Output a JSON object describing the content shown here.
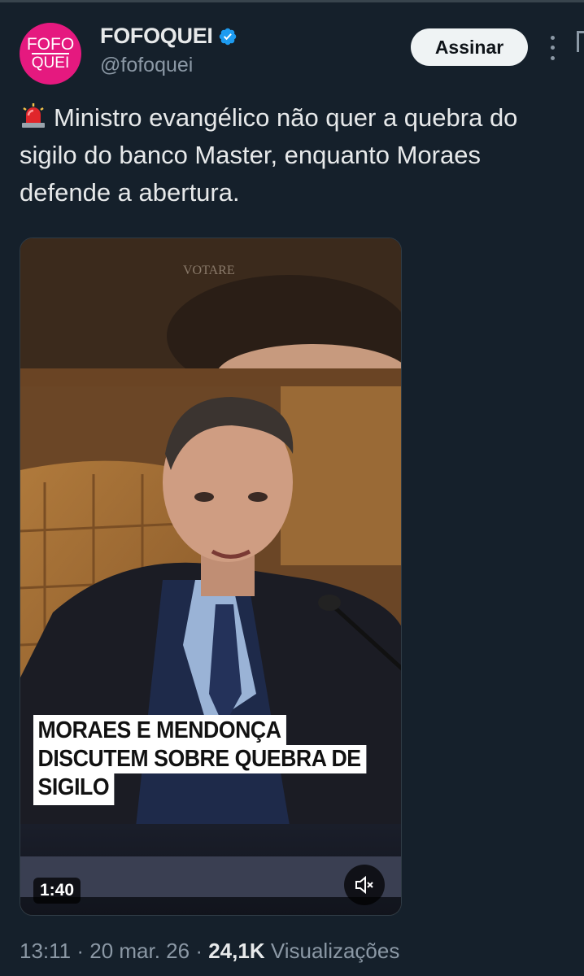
{
  "account": {
    "display_name": "FOFOQUEI",
    "handle": "@fofoquei",
    "avatar_logo_top": "FOFO",
    "avatar_logo_bottom": "QUEI",
    "avatar_color": "#e5197f",
    "verified": true,
    "verified_color": "#1d9bf0"
  },
  "actions": {
    "subscribe_label": "Assinar",
    "more_icon": "more-vertical-icon"
  },
  "tweet": {
    "emoji_icon": "siren-icon",
    "text": "Ministro evangélico não quer a quebra do sigilo do banco Master, enquanto Moraes defende a abertura."
  },
  "video": {
    "duration": "1:40",
    "caption_lines": [
      "MORAES E MENDONÇA",
      "DISCUTEM SOBRE QUEBRA DE",
      "SIGILO"
    ],
    "background_text": "VOTARE",
    "mute_icon": "muted-speaker-icon"
  },
  "meta": {
    "time": "13:11",
    "separator": " · ",
    "date": "20 mar. 26",
    "views_count": "24,1K",
    "views_label": "Visualizações"
  },
  "colors": {
    "background": "#15202b",
    "primary_text": "#e7e9ea",
    "secondary_text": "#8b98a5",
    "button_bg": "#eff3f4"
  }
}
